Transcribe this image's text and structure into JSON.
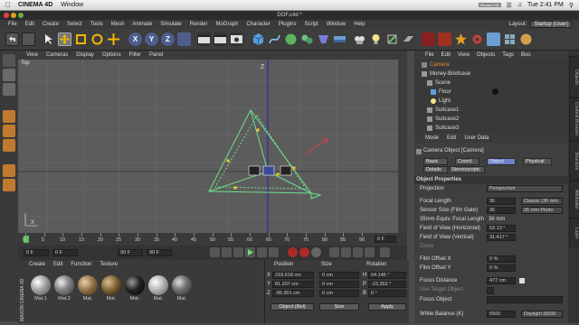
{
  "mac_menu": {
    "app": "CINEMA 4D",
    "window": "Window",
    "status": "iShowU HD",
    "time": "Tue 2:41 PM"
  },
  "window_title": "DOF.c4d *",
  "app_menu": {
    "items": [
      "File",
      "Edit",
      "Create",
      "Select",
      "Tools",
      "Mesh",
      "Animate",
      "Simulate",
      "Render",
      "MoGraph",
      "Character",
      "Plugins",
      "Script",
      "Window",
      "Help"
    ],
    "layout_label": "Layout:",
    "layout_value": "Startup (User)"
  },
  "viewport": {
    "menu": [
      "View",
      "Cameras",
      "Display",
      "Options",
      "Filter",
      "Panel"
    ],
    "label": "Top",
    "axis_y": "Z",
    "axis_x": "X"
  },
  "timeline": {
    "ticks": [
      "0",
      "5",
      "10",
      "15",
      "20",
      "25",
      "30",
      "35",
      "40",
      "45",
      "50",
      "55",
      "60",
      "65",
      "70",
      "75",
      "80",
      "85",
      "90"
    ],
    "end_frame": "0 F"
  },
  "transport": {
    "start": "0 F",
    "current": "0 F",
    "end": "90 F",
    "end2": "90 F"
  },
  "materials": {
    "menu": [
      "Create",
      "Edit",
      "Function",
      "Texture"
    ],
    "items": [
      "Mat.1",
      "Mat.2",
      "Mat.",
      "Mat.",
      "Mat.",
      "Mat.",
      "Mat."
    ],
    "brand": "MAXON CINEMA 4D"
  },
  "coords": {
    "headers": [
      "Position",
      "Size",
      "Rotation"
    ],
    "rows": [
      {
        "axis": "X",
        "pos": "218.618 cm",
        "size": "0 cm",
        "rot_label": "H",
        "rot": "64.146 °"
      },
      {
        "axis": "Y",
        "pos": "81.207 cm",
        "size": "0 cm",
        "rot_label": "P",
        "rot": "-23.352 °"
      },
      {
        "axis": "Z",
        "pos": "-85.901 cm",
        "size": "0 cm",
        "rot_label": "B",
        "rot": "0 °"
      }
    ],
    "mode": "Object (Rel)",
    "size_mode": "Size",
    "apply": "Apply"
  },
  "object_manager": {
    "menu": [
      "File",
      "Edit",
      "View",
      "Objects",
      "Tags",
      "Boo"
    ],
    "objects": [
      "Camera",
      "Money-Briefcase",
      "Scene",
      "Floor",
      "Light",
      "Suitcase1",
      "Suitcase2",
      "Suitcase3"
    ]
  },
  "attributes": {
    "menu": [
      "Mode",
      "Edit",
      "User Data"
    ],
    "object_title": "Camera Object [Camera]",
    "tabs": [
      "Basic",
      "Coord.",
      "Object",
      "Physical",
      "Details",
      "Stereoscopic"
    ],
    "section": "Object Properties",
    "fields": [
      {
        "label": "Projection",
        "value": "Perspective",
        "extra": ""
      },
      {
        "label": "Focal Length",
        "value": "36",
        "extra": "Classic (36 mm"
      },
      {
        "label": "Sensor Size (Film Gate)",
        "value": "36",
        "extra": "35 mm Photo"
      },
      {
        "label": "35mm Equiv. Focal Length",
        "value": "36 mm",
        "extra": ""
      },
      {
        "label": "Field of View (Horizontal)",
        "value": "53.13 °",
        "extra": ""
      },
      {
        "label": "Field of View (Vertical)",
        "value": "31.417 °",
        "extra": ""
      },
      {
        "label": "Zoom",
        "value": "",
        "extra": ""
      },
      {
        "label": "Film Offset X",
        "value": "0 %",
        "extra": ""
      },
      {
        "label": "Film Offset Y",
        "value": "0 %",
        "extra": ""
      },
      {
        "label": "Focus Distance",
        "value": "477 cm",
        "extra": ""
      },
      {
        "label": "Use Target Object",
        "value": "",
        "extra": ""
      },
      {
        "label": "Focus Object",
        "value": "",
        "extra": ""
      },
      {
        "label": "White Balance (K)",
        "value": "6500",
        "extra": "Daylight (6500"
      }
    ]
  },
  "right_tabs": [
    "Objects",
    "Content Browser",
    "Structure",
    "Attributes",
    "Layer"
  ]
}
